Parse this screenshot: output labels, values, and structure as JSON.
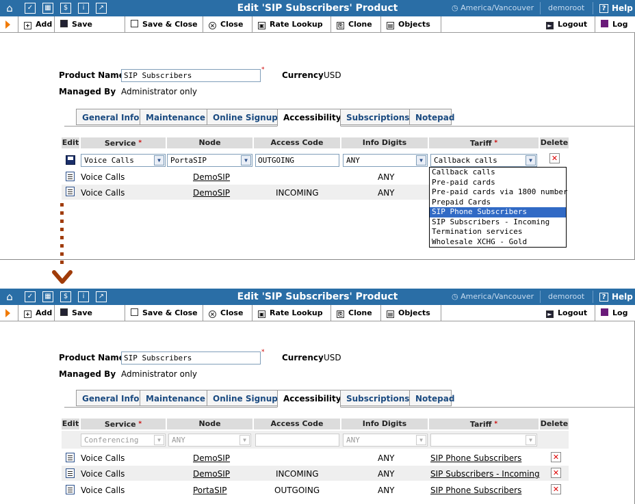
{
  "window": {
    "title": "Edit 'SIP Subscribers' Product",
    "timezone": "America/Vancouver",
    "user": "demoroot",
    "help": "Help"
  },
  "toolbar": {
    "add": "Add",
    "save": "Save",
    "save_close": "Save & Close",
    "close": "Close",
    "rate_lookup": "Rate Lookup",
    "clone": "Clone",
    "objects": "Objects",
    "logout": "Logout",
    "log": "Log"
  },
  "form": {
    "product_name_label": "Product Name",
    "product_name_value": "SIP Subscribers",
    "currency_label": "Currency",
    "currency_value": "USD",
    "managed_by_label": "Managed By",
    "managed_by_value": "Administrator only"
  },
  "tabs": [
    "General Info",
    "Maintenance",
    "Online Signup",
    "Accessibility",
    "Subscriptions",
    "Notepad"
  ],
  "table": {
    "headers": {
      "edit": "Edit",
      "service": "Service",
      "node": "Node",
      "access_code": "Access Code",
      "info_digits": "Info Digits",
      "tariff": "Tariff",
      "delete": "Delete"
    }
  },
  "before": {
    "edit_row": {
      "service": "Voice Calls",
      "node": "PortaSIP",
      "access_code": "OUTGOING",
      "info_digits": "ANY",
      "tariff": "Callback calls"
    },
    "rows": [
      {
        "service": "Voice Calls",
        "node": "DemoSIP",
        "access_code": "",
        "info_digits": "ANY"
      },
      {
        "service": "Voice Calls",
        "node": "DemoSIP",
        "access_code": "INCOMING",
        "info_digits": "ANY"
      }
    ],
    "tariff_options": [
      "Callback calls",
      "Pre-paid cards",
      "Pre-paid cards via 1800 number",
      "Prepaid Cards",
      "SIP Phone Subscribers",
      "SIP Subscribers - Incoming",
      "Termination services",
      "Wholesale XCHG - Gold"
    ],
    "tariff_highlighted": "SIP Phone Subscribers"
  },
  "after": {
    "new_row": {
      "service": "Conferencing",
      "node": "ANY",
      "access_code": "",
      "info_digits": "ANY",
      "tariff": ""
    },
    "rows": [
      {
        "service": "Voice Calls",
        "node": "DemoSIP",
        "access_code": "",
        "info_digits": "ANY",
        "tariff": "SIP Phone Subscribers"
      },
      {
        "service": "Voice Calls",
        "node": "DemoSIP",
        "access_code": "INCOMING",
        "info_digits": "ANY",
        "tariff": "SIP Subscribers - Incoming"
      },
      {
        "service": "Voice Calls",
        "node": "PortaSIP",
        "access_code": "OUTGOING",
        "info_digits": "ANY",
        "tariff": "SIP Phone Subscribers"
      }
    ]
  },
  "icons": {
    "home": "home-icon",
    "check": "check-icon",
    "grid": "grid-icon",
    "dollar": "dollar-icon",
    "info": "info-icon",
    "chart": "chart-icon",
    "clock": "clock-icon",
    "help": "help-icon",
    "save": "floppy-disk-icon",
    "edit": "edit-list-icon",
    "delete": "delete-x-icon",
    "arrow": "chevron-down-icon"
  },
  "colors": {
    "titlebar": "#2a6ea6",
    "accent_orange": "#f07a00",
    "arrow_brown": "#a03c0a",
    "highlight": "#316ac5"
  }
}
